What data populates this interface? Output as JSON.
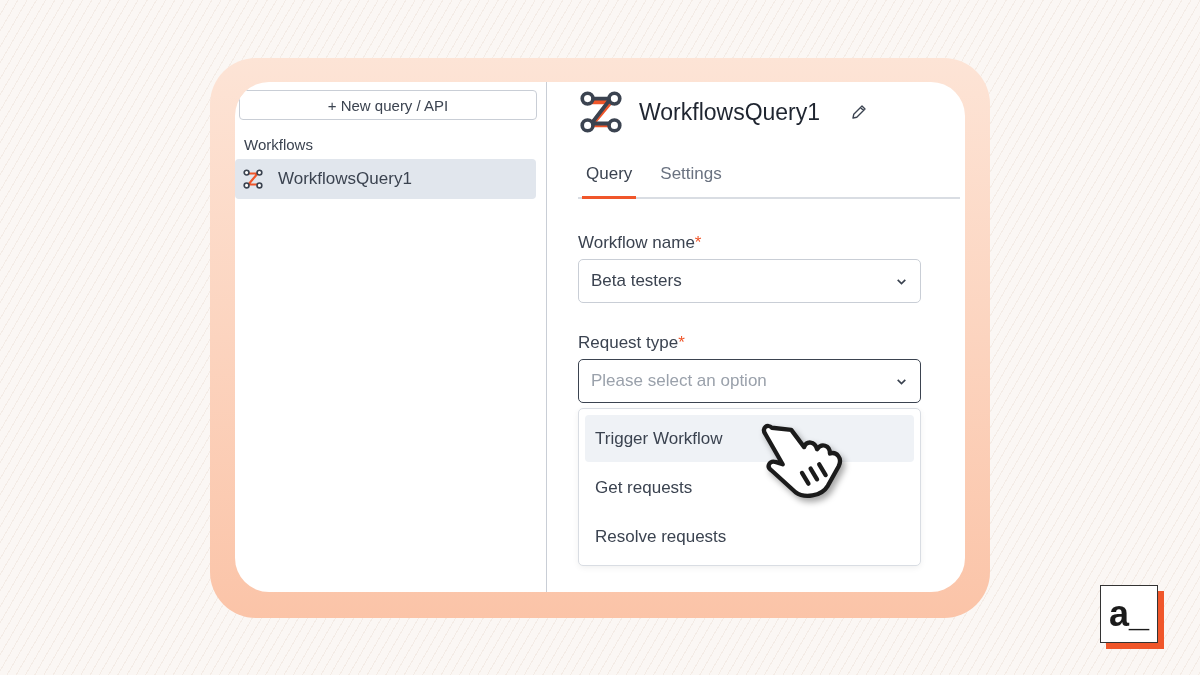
{
  "sidebar": {
    "new_button": "+ New query / API",
    "section_label": "Workflows",
    "items": [
      {
        "label": "WorkflowsQuery1",
        "selected": true
      }
    ]
  },
  "header": {
    "title": "WorkflowsQuery1"
  },
  "tabs": [
    {
      "label": "Query",
      "selected": true
    },
    {
      "label": "Settings",
      "selected": false
    }
  ],
  "fields": [
    {
      "label": "Workflow name",
      "required_mark": "*",
      "value": "Beta testers",
      "open": false
    },
    {
      "label": "Request type",
      "required_mark": "*",
      "placeholder": "Please select an option",
      "open": true,
      "options": [
        {
          "label": "Trigger Workflow",
          "selected": true
        },
        {
          "label": "Get requests",
          "selected": false
        },
        {
          "label": "Resolve requests",
          "selected": false
        }
      ]
    }
  ],
  "logo": {
    "text": "a_"
  }
}
